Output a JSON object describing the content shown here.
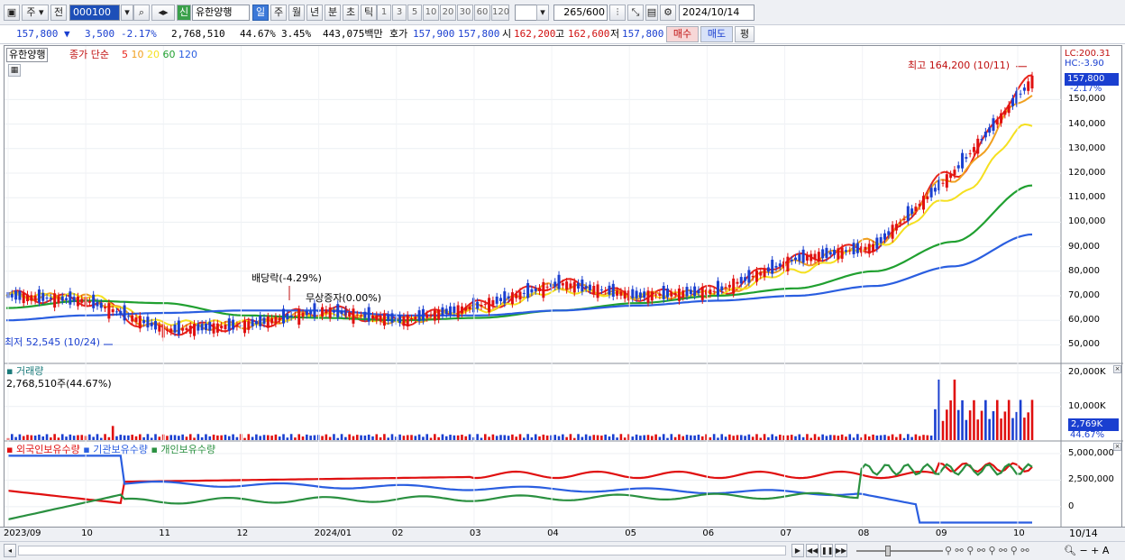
{
  "toolbar": {
    "market": "주",
    "prev": "전",
    "code": "000100",
    "new_badge": "신",
    "stock_name": "유한양행",
    "periods": [
      "일",
      "주",
      "월",
      "년",
      "분",
      "초",
      "틱"
    ],
    "selected_period": "일",
    "intervals": [
      "1",
      "3",
      "5",
      "10",
      "20",
      "30",
      "60",
      "120"
    ],
    "count_value": "265",
    "count_total": "/600",
    "date": "2024/10/14"
  },
  "quote": {
    "price": "157,800",
    "change": "3,500",
    "change_pct": "-2.17%",
    "volume": "2,768,510",
    "turnover_pct": "44.67%",
    "rate2": "3.45%",
    "amount": "443,075백만",
    "bid_ask_label": "호가",
    "ask": "157,900",
    "bid": "157,800",
    "open_label": "시",
    "open": "162,200",
    "high_label": "고",
    "high": "162,600",
    "low_label": "저",
    "low": "157,800",
    "buy_button": "매수",
    "sell_button": "매도",
    "eval_button": "평"
  },
  "price_panel": {
    "name": "유한양행",
    "ma_label": "종가 단순",
    "ma_periods": [
      {
        "label": "5",
        "color": "#e8251c"
      },
      {
        "label": "10",
        "color": "#f0a020"
      },
      {
        "label": "20",
        "color": "#f5e020"
      },
      {
        "label": "60",
        "color": "#20a030"
      },
      {
        "label": "120",
        "color": "#2a5ee0"
      }
    ],
    "lc": "LC:200.31",
    "hc": "HC:-3.90",
    "current_tag": "157,800",
    "current_pct": "-2.17%",
    "max_annotation": "최고 164,200 (10/11)",
    "min_annotation": "최저 52,545 (10/24)",
    "dividend_annotation": "배당락(-4.29%)",
    "rights_annotation": "무상증자(0.00%)",
    "y_ticks": [
      "150,000",
      "140,000",
      "130,000",
      "120,000",
      "110,000",
      "100,000",
      "90,000",
      "80,000",
      "70,000",
      "60,000",
      "50,000"
    ]
  },
  "volume_panel": {
    "title": "거래량",
    "value": "2,768,510주(44.67%)",
    "y_ticks": [
      "20,000K",
      "10,000K"
    ],
    "current_tag": "2,769K",
    "current_pct": "44.67%"
  },
  "holding_panel": {
    "series": [
      {
        "label": "외국인보유수량",
        "color": "#e01010"
      },
      {
        "label": "기관보유수량",
        "color": "#2a5ee0"
      },
      {
        "label": "개인보유수량",
        "color": "#2a9040"
      }
    ],
    "y_ticks": [
      "5,000,000",
      "2,500,000",
      "0"
    ]
  },
  "x_axis": {
    "labels": [
      "2023/09",
      "10",
      "11",
      "12",
      "2024/01",
      "02",
      "03",
      "04",
      "05",
      "06",
      "07",
      "08",
      "09",
      "10"
    ],
    "last_date": "10/14"
  },
  "chart_data": {
    "type": "line",
    "title": "유한양행",
    "ylabel": "",
    "ylim": [
      45000,
      170000
    ],
    "x": [
      "2023/09",
      "2023/10",
      "2023/11",
      "2023/12",
      "2024/01",
      "2024/02",
      "2024/03",
      "2024/04",
      "2024/05",
      "2024/06",
      "2024/07",
      "2024/08",
      "2024/09",
      "2024/10/14"
    ],
    "series": [
      {
        "name": "5",
        "values": [
          70000,
          68000,
          56000,
          58000,
          64000,
          60000,
          66000,
          75000,
          70000,
          72000,
          85000,
          90000,
          120000,
          157800
        ]
      },
      {
        "name": "10",
        "values": [
          70000,
          69000,
          57000,
          58000,
          63000,
          60000,
          65000,
          74000,
          70000,
          71000,
          83000,
          92000,
          118000,
          152000
        ]
      },
      {
        "name": "20",
        "values": [
          70000,
          70000,
          59000,
          59000,
          62000,
          60000,
          64000,
          72000,
          70000,
          71000,
          80000,
          90000,
          110000,
          140000
        ]
      },
      {
        "name": "60",
        "values": [
          65000,
          68000,
          67000,
          62000,
          61000,
          60000,
          61000,
          64000,
          67000,
          70000,
          73000,
          80000,
          92000,
          115000
        ]
      },
      {
        "name": "120",
        "values": [
          60000,
          62000,
          63000,
          64000,
          64000,
          62000,
          62000,
          64000,
          66000,
          68000,
          70000,
          74000,
          82000,
          95000
        ]
      }
    ],
    "max_point": {
      "date": "10/11",
      "value": 164200
    },
    "min_point": {
      "date": "10/24",
      "value": 52545
    }
  }
}
